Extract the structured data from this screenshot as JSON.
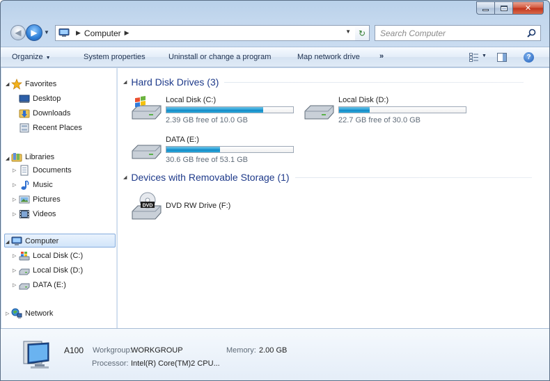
{
  "address": {
    "crumbs": [
      "Computer"
    ]
  },
  "search": {
    "placeholder": "Search Computer"
  },
  "toolbar": {
    "organize": "Organize",
    "system_properties": "System properties",
    "uninstall": "Uninstall or change a program",
    "map_drive": "Map network drive",
    "more": "»"
  },
  "nav": {
    "favorites": "Favorites",
    "desktop": "Desktop",
    "downloads": "Downloads",
    "recent_places": "Recent Places",
    "libraries": "Libraries",
    "documents": "Documents",
    "music": "Music",
    "pictures": "Pictures",
    "videos": "Videos",
    "computer": "Computer",
    "local_c": "Local Disk (C:)",
    "local_d": "Local Disk (D:)",
    "data_e": "DATA (E:)",
    "network": "Network"
  },
  "groups": {
    "hdd": "Hard Disk Drives (3)",
    "removable": "Devices with Removable Storage (1)"
  },
  "drives": [
    {
      "name": "Local Disk (C:)",
      "free_text": "2.39 GB free of 10.0 GB",
      "used_fraction": 0.761
    },
    {
      "name": "Local Disk (D:)",
      "free_text": "22.7 GB free of 30.0 GB",
      "used_fraction": 0.243
    },
    {
      "name": "DATA (E:)",
      "free_text": "30.6 GB free of 53.1 GB",
      "used_fraction": 0.424
    }
  ],
  "removable": [
    {
      "name": "DVD RW Drive (F:)",
      "badge": "DVD"
    }
  ],
  "details": {
    "computer_name": "A100",
    "workgroup_label": "Workgroup:",
    "workgroup": "WORKGROUP",
    "memory_label": "Memory:",
    "memory": "2.00 GB",
    "processor_label": "Processor:",
    "processor": "Intel(R) Core(TM)2 CPU..."
  },
  "colors": {
    "accent": "#1e3a8a",
    "bar_fill": "#26a0da",
    "close": "#c7432a"
  }
}
